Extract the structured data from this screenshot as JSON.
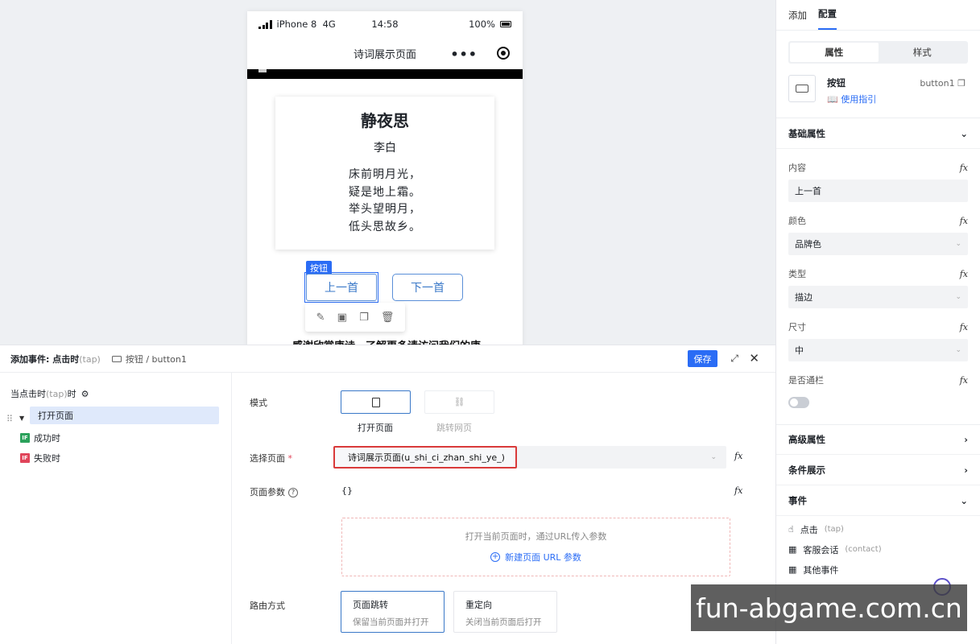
{
  "phone": {
    "carrier": "iPhone 8",
    "network": "4G",
    "time": "14:58",
    "battery": "100%",
    "page_title": "诗词展示页面",
    "more_glyph": "•••",
    "poem": {
      "title": "静夜思",
      "author": "李白",
      "lines": [
        "床前明月光，",
        "疑是地上霜。",
        "举头望明月，",
        "低头思故乡。"
      ]
    },
    "selection_tag": "按钮",
    "prev_button": "上一首",
    "next_button": "下一首",
    "footer_text": "感谢欣赏唐诗，了解更多请访问我们的唐"
  },
  "right_panel": {
    "tabs": [
      {
        "label": "添加"
      },
      {
        "label": "配置"
      }
    ],
    "segments": [
      {
        "label": "属性"
      },
      {
        "label": "样式"
      }
    ],
    "component": {
      "name": "按钮",
      "guide": "使用指引",
      "id": "button1"
    },
    "basic_section": "基础属性",
    "fx": "fx",
    "props": [
      {
        "label": "内容",
        "value": "上一首"
      },
      {
        "label": "颜色",
        "value": "品牌色"
      },
      {
        "label": "类型",
        "value": "描边"
      },
      {
        "label": "尺寸",
        "value": "中"
      }
    ],
    "toggle_label": "是否通栏",
    "advanced_section": "高级属性",
    "condition_section": "条件展示",
    "event_section": "事件",
    "events": [
      {
        "label": "点击",
        "sub": "(tap)"
      },
      {
        "label": "客服会话",
        "sub": "(contact)"
      },
      {
        "label": "其他事件",
        "sub": ""
      }
    ]
  },
  "event_panel": {
    "title": "添加事件: 点击时",
    "title_sub": "(tap)",
    "breadcrumb": "按钮 / button1",
    "save": "保存",
    "tree_head": "当点击时",
    "tree_head_sub": "(tap)",
    "tree_head_suffix": "时",
    "action": "打开页面",
    "success": "成功时",
    "fail": "失败时",
    "if_badge": "IF",
    "mode_label": "模式",
    "mode_open": "打开页面",
    "mode_web": "跳转网页",
    "select_page_label": "选择页面",
    "required_mark": "*",
    "select_page_value": "诗词展示页面(u_shi_ci_zhan_shi_ye_)",
    "params_label": "页面参数",
    "params_value": "{}",
    "params_hint": "打开当前页面时，通过URL传入参数",
    "params_add": "新建页面 URL 参数",
    "route_label": "路由方式",
    "route_options": [
      {
        "title": "页面跳转",
        "sub": "保留当前页面并打开"
      },
      {
        "title": "重定向",
        "sub": "关闭当前页面后打开"
      }
    ]
  },
  "watermark": "fun-abgame.com.cn"
}
